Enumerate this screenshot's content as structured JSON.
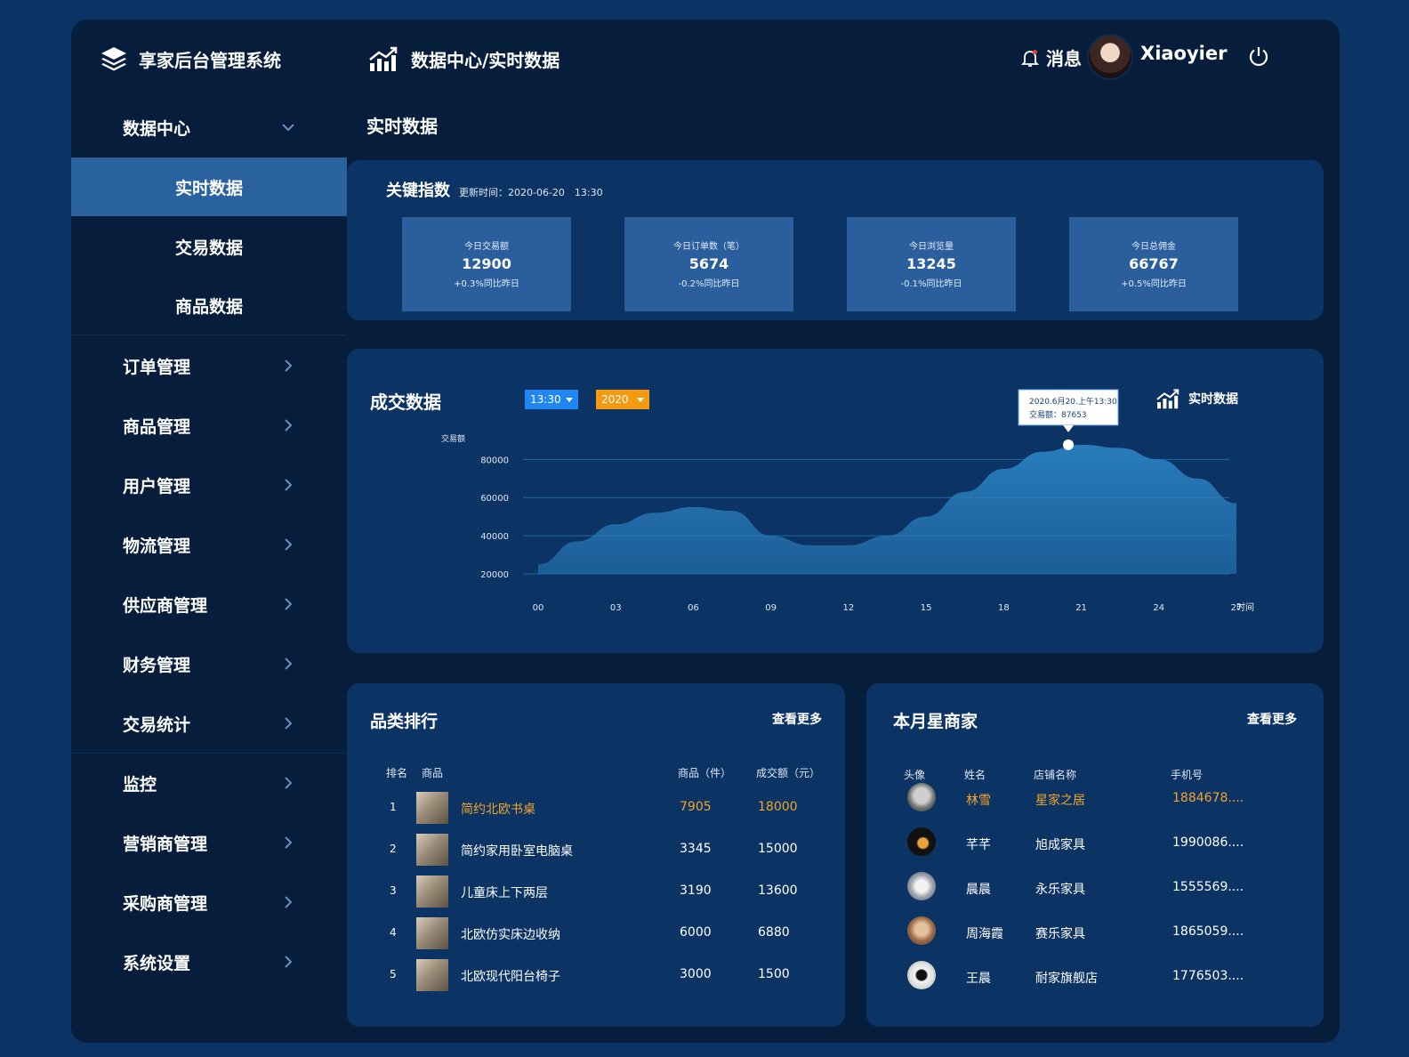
{
  "brand": {
    "title": "享家后台管理系统",
    "icon": "layers-icon"
  },
  "header": {
    "breadcrumb": "数据中心/实时数据",
    "breadcrumb_icon": "trend-chart-icon",
    "message_label": "消息",
    "username": "Xiaoyier"
  },
  "sidebar": {
    "data_center": {
      "label": "数据中心",
      "icon": "chevron-down-icon"
    },
    "sub_items": [
      {
        "label": "实时数据",
        "active": true
      },
      {
        "label": "交易数据",
        "active": false
      },
      {
        "label": "商品数据",
        "active": false
      }
    ],
    "items": [
      {
        "label": "订单管理"
      },
      {
        "label": "商品管理"
      },
      {
        "label": "用户管理"
      },
      {
        "label": "物流管理"
      },
      {
        "label": "供应商管理"
      },
      {
        "label": "财务管理"
      },
      {
        "label": "交易统计"
      },
      {
        "label": "监控"
      },
      {
        "label": "营销商管理"
      },
      {
        "label": "采购商管理"
      },
      {
        "label": "系统设置"
      }
    ]
  },
  "page_title": "实时数据",
  "key_indicators": {
    "title": "关键指数",
    "update_time": "更新时间：2020-06-20　13:30",
    "cards": [
      {
        "label": "今日交易额",
        "value": "12900",
        "change": "+0.3%同比昨日"
      },
      {
        "label": "今日订单数（笔）",
        "value": "5674",
        "change": "-0.2%同比昨日"
      },
      {
        "label": "今日浏览量",
        "value": "13245",
        "change": "-0.1%同比昨日"
      },
      {
        "label": "今日总佣金",
        "value": "66767",
        "change": "+0.5%同比昨日"
      }
    ]
  },
  "deal_chart": {
    "title": "成交数据",
    "time_select": "13:30",
    "year_select": "2020",
    "live_label": "实时数据",
    "tooltip_line1": "2020.6月20.上午13:30",
    "tooltip_line2": "交易额：87653",
    "colors": {
      "area": "#2a80c0",
      "grid": "#1d6aa0",
      "time_select": "#1f86f2",
      "year_select": "#f39a12"
    }
  },
  "chart_data": {
    "type": "area",
    "ylabel": "交易额",
    "xlabel": "时间",
    "x_ticks": [
      "00",
      "03",
      "06",
      "09",
      "12",
      "15",
      "18",
      "21",
      "24",
      "27"
    ],
    "y_ticks": [
      20000,
      40000,
      60000,
      80000
    ],
    "x": [
      0,
      1.5,
      3,
      4.5,
      6,
      7.5,
      9,
      10.5,
      12,
      13.5,
      15,
      16.5,
      18,
      19.5,
      21,
      22.5,
      24,
      25.5,
      27
    ],
    "values": [
      25000,
      37000,
      46000,
      52000,
      55000,
      53000,
      40000,
      35000,
      35000,
      40000,
      50000,
      63000,
      75000,
      84000,
      87653,
      86000,
      80000,
      70000,
      57000
    ],
    "highlight": {
      "x": 20.5,
      "y": 87653
    },
    "ylim": [
      20000,
      96000
    ],
    "xlim": [
      0,
      27
    ],
    "grid": true
  },
  "category_rank": {
    "title": "品类排行",
    "more": "查看更多",
    "headers": {
      "rank": "排名",
      "product": "商品",
      "count": "商品（件）",
      "amount": "成交额（元）"
    },
    "rows": [
      {
        "rank": "1",
        "name": "简约北欧书桌",
        "count": "7905",
        "amount": "18000"
      },
      {
        "rank": "2",
        "name": "简约家用卧室电脑桌",
        "count": "3345",
        "amount": "15000"
      },
      {
        "rank": "3",
        "name": "儿童床上下两层",
        "count": "3190",
        "amount": "13600"
      },
      {
        "rank": "4",
        "name": "北欧仿实床边收纳",
        "count": "6000",
        "amount": "6880"
      },
      {
        "rank": "5",
        "name": "北欧现代阳台椅子",
        "count": "3000",
        "amount": "1500"
      }
    ]
  },
  "star_merchants": {
    "title": "本月星商家",
    "more": "查看更多",
    "headers": {
      "avatar": "头像",
      "name": "姓名",
      "shop": "店铺名称",
      "phone": "手机号"
    },
    "rows": [
      {
        "name": "林雪",
        "shop": "星家之居",
        "phone": "1884678...."
      },
      {
        "name": "芊芊",
        "shop": "旭成家具",
        "phone": "1990086...."
      },
      {
        "name": "晨晨",
        "shop": "永乐家具",
        "phone": "1555569...."
      },
      {
        "name": "周海霞",
        "shop": "赛乐家具",
        "phone": "1865059...."
      },
      {
        "name": "王晨",
        "shop": "耐家旗舰店",
        "phone": "1776503...."
      }
    ]
  }
}
